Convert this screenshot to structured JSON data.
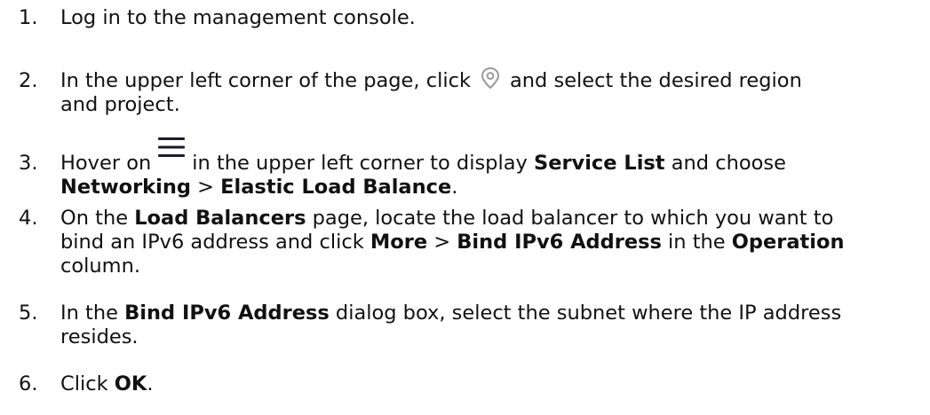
{
  "steps": [
    {
      "number": "1.",
      "text": "Log in to the management console."
    },
    {
      "number": "2.",
      "text_before": "In the upper left corner of the page, click",
      "icon": "location-pin-icon",
      "text_after": "and select the desired region",
      "text_line2": "and project."
    },
    {
      "number": "3.",
      "text_before": "Hover on",
      "icon": "hamburger-menu-icon",
      "text_mid": "in the upper left corner to display",
      "bold_service_list": "Service List",
      "text_and_choose": "and choose",
      "bold_networking": "Networking",
      "sep": ">",
      "bold_elb": "Elastic Load Balance",
      "end": "."
    },
    {
      "number": "4.",
      "text_on_the": "On the",
      "bold_load_balancers": "Load Balancers",
      "text_page_locate": "page, locate the load balancer to which you want to",
      "text_bind_and_click": "bind an IPv6 address and click",
      "bold_more": "More",
      "sep": ">",
      "bold_bind_ipv6": "Bind IPv6 Address",
      "text_in_the": "in the",
      "bold_operation": "Operation",
      "text_column": "column."
    },
    {
      "number": "5.",
      "text_in_the": "In the",
      "bold_dialog": "Bind IPv6 Address",
      "text_dialog_rest": "dialog box, select the subnet where the IP address",
      "text_line2": "resides."
    },
    {
      "number": "6.",
      "text_click": "Click",
      "bold_ok": "OK",
      "end": "."
    }
  ],
  "colors": {
    "text": "#111111",
    "pin_icon": "#9a9a9a",
    "menu_icon": "#1a1a2e"
  }
}
